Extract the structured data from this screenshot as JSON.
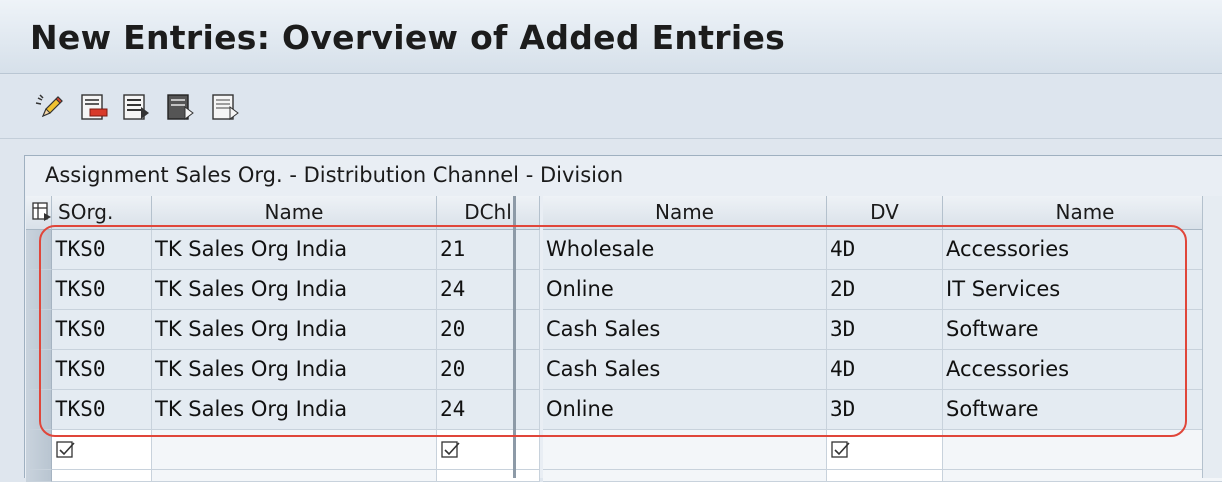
{
  "window": {
    "title": "New Entries: Overview of Added Entries"
  },
  "toolbar": {
    "icons": [
      "change-pencil-icon",
      "delete-entries-icon",
      "select-all-icon",
      "select-block-icon",
      "deselect-all-icon"
    ]
  },
  "table": {
    "title": "Assignment Sales Org. - Distribution Channel - Division",
    "columns": [
      "SOrg.",
      "Name",
      "DChl",
      "Name",
      "DV",
      "Name"
    ],
    "rows": [
      {
        "sorg": "TKS0",
        "sorg_name": "TK Sales Org India",
        "dchl": "21",
        "dchl_name": "Wholesale",
        "dv": "4D",
        "dv_name": "Accessories"
      },
      {
        "sorg": "TKS0",
        "sorg_name": "TK Sales Org India",
        "dchl": "24",
        "dchl_name": "Online",
        "dv": "2D",
        "dv_name": "IT Services"
      },
      {
        "sorg": "TKS0",
        "sorg_name": "TK Sales Org India",
        "dchl": "20",
        "dchl_name": "Cash Sales",
        "dv": "3D",
        "dv_name": "Software"
      },
      {
        "sorg": "TKS0",
        "sorg_name": "TK Sales Org India",
        "dchl": "20",
        "dchl_name": "Cash Sales",
        "dv": "4D",
        "dv_name": "Accessories"
      },
      {
        "sorg": "TKS0",
        "sorg_name": "TK Sales Org India",
        "dchl": "24",
        "dchl_name": "Online",
        "dv": "3D",
        "dv_name": "Software"
      }
    ]
  },
  "colors": {
    "highlight": "#e0463a",
    "background": "#dfe6ee"
  }
}
